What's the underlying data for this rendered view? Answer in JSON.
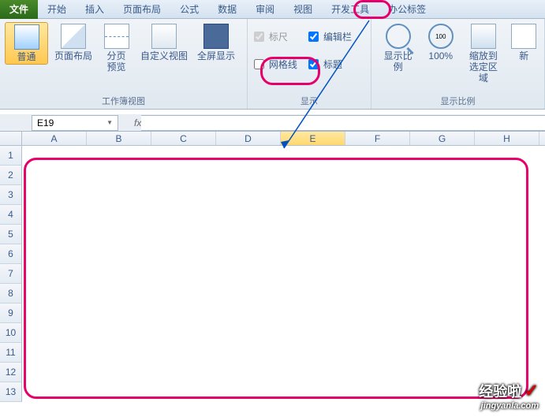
{
  "menu": {
    "file": "文件",
    "home": "开始",
    "insert": "插入",
    "pageLayout": "页面布局",
    "formulas": "公式",
    "data": "数据",
    "review": "审阅",
    "view": "视图",
    "developer": "开发工具",
    "officeTab": "办公标签"
  },
  "ribbon": {
    "normal": "普通",
    "pageLayout": "页面布局",
    "pageBreak": "分页\n预览",
    "customView": "自定义视图",
    "fullScreen": "全屏显示",
    "groupWorkbookViews": "工作簿视图",
    "ruler": "标尺",
    "formulaBar": "编辑栏",
    "gridlines": "网格线",
    "headings": "标题",
    "groupShow": "显示",
    "zoom": "显示比例",
    "zoom100": "100%",
    "zoomSelection": "缩放到\n选定区域",
    "groupZoom": "显示比例",
    "newWindow": "新"
  },
  "nameBox": "E19",
  "fx": "fx",
  "columns": [
    "A",
    "B",
    "C",
    "D",
    "E",
    "F",
    "G",
    "H"
  ],
  "rows": [
    "1",
    "2",
    "3",
    "4",
    "5",
    "6",
    "7",
    "8",
    "9",
    "10",
    "11",
    "12",
    "13"
  ],
  "checkStates": {
    "ruler": true,
    "formulaBar": true,
    "gridlines": false,
    "headings": true
  },
  "watermark": {
    "main": "经验啦",
    "sub": "jingyanla.com"
  }
}
